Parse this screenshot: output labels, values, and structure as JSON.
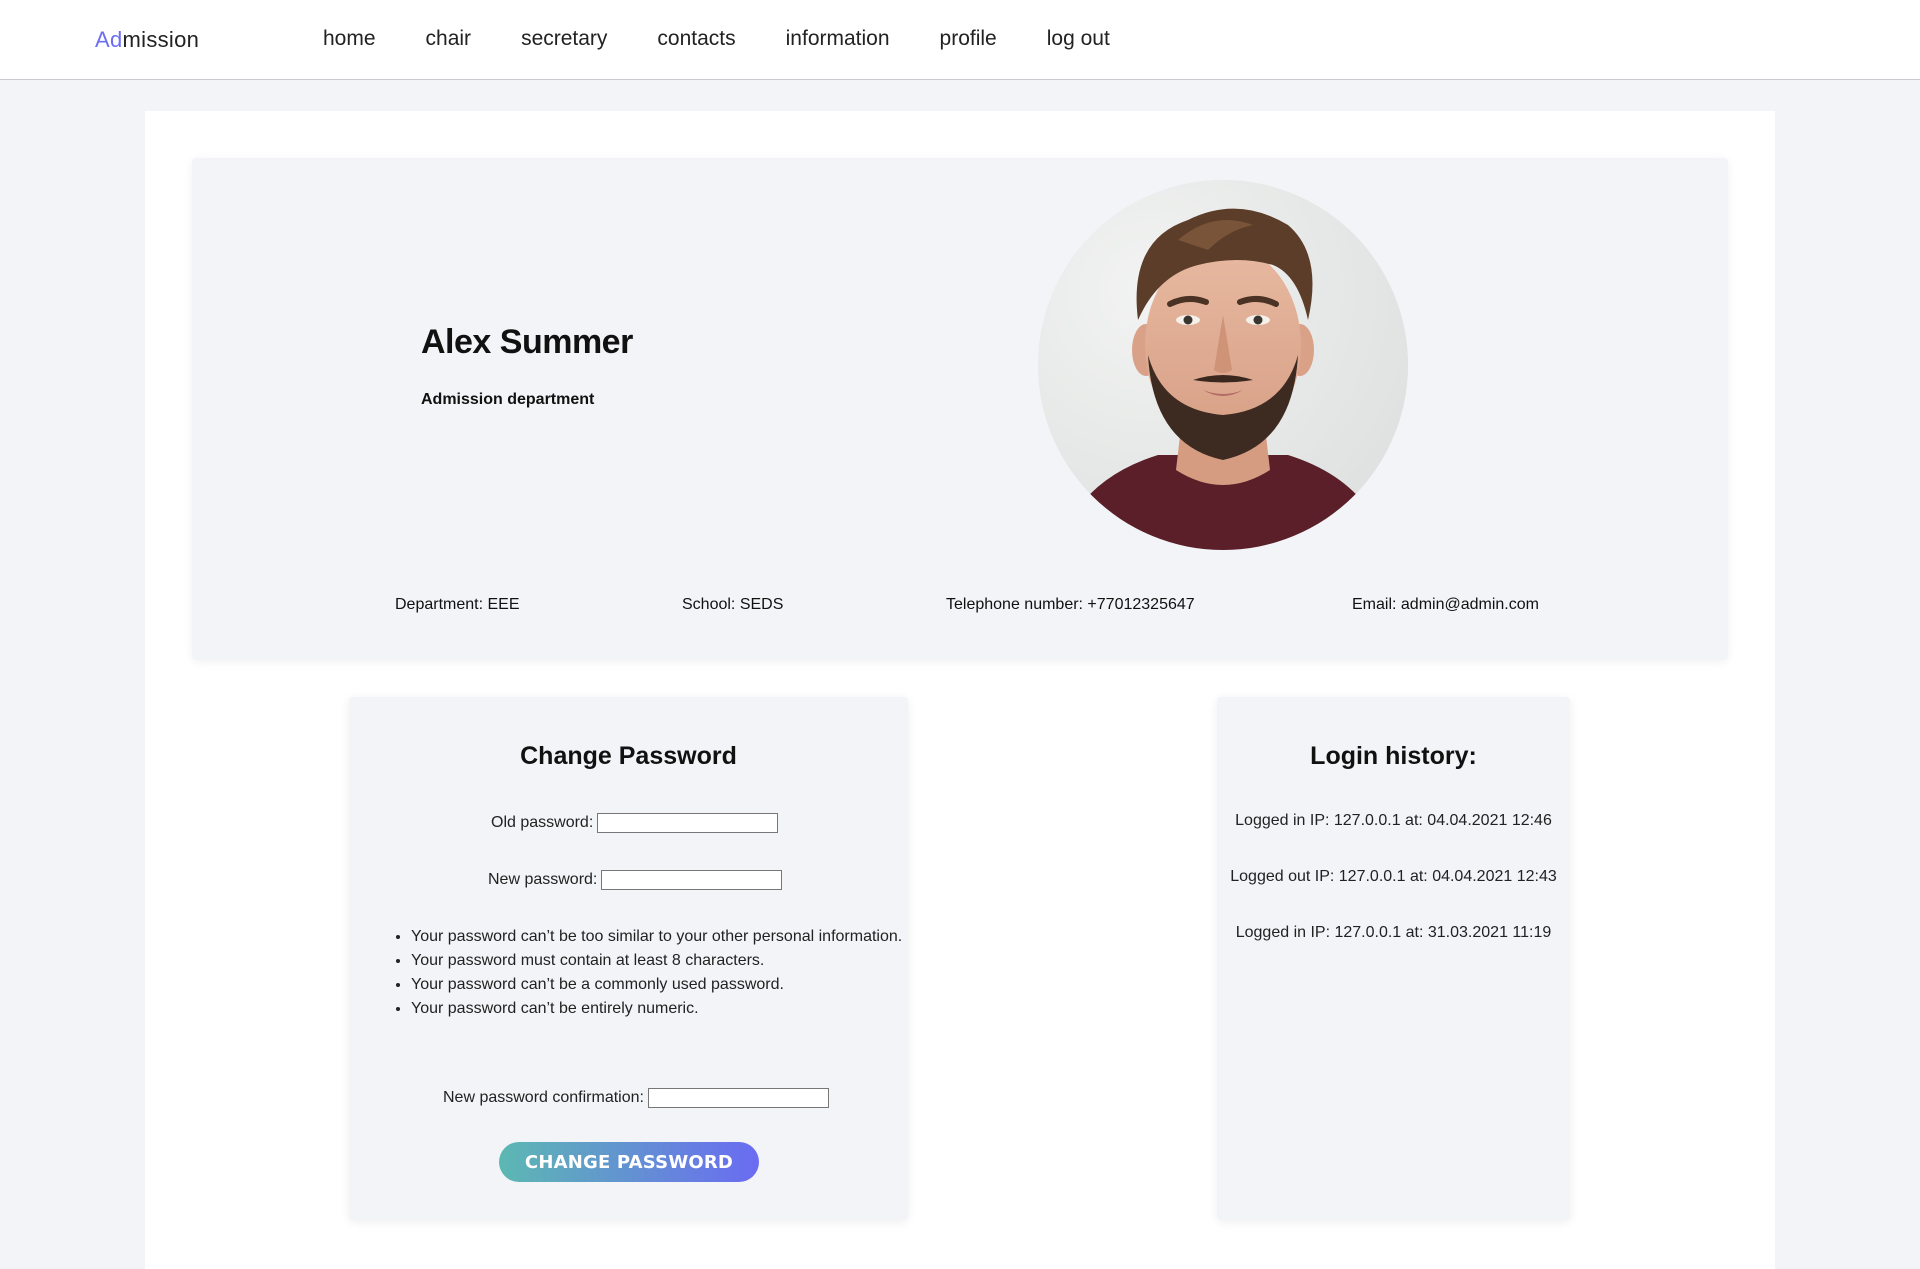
{
  "nav": {
    "brand_accent": "Ad",
    "brand_rest": "mission",
    "links": [
      "home",
      "chair",
      "secretary",
      "contacts",
      "information",
      "profile",
      "log out"
    ]
  },
  "profile": {
    "name": "Alex Summer",
    "department_title": "Admission department",
    "department": "Department: EEE",
    "school": "School: SEDS",
    "telephone": "Telephone number: +77012325647",
    "email": "Email: admin@admin.com"
  },
  "change_password": {
    "title": "Change Password",
    "old_label": "Old password:",
    "new_label": "New password:",
    "confirm_label": "New password confirmation:",
    "old_value": "",
    "new_value": "",
    "confirm_value": "",
    "rules": [
      "Your password can’t be too similar to your other personal information.",
      "Your password must contain at least 8 characters.",
      "Your password can’t be a commonly used password.",
      "Your password can’t be entirely numeric."
    ],
    "button_label": "CHANGE PASSWORD"
  },
  "login_history": {
    "title": "Login history:",
    "entries": [
      "Logged in IP: 127.0.0.1 at: 04.04.2021 12:46",
      "Logged out IP: 127.0.0.1 at: 04.04.2021 12:43",
      "Logged in IP: 127.0.0.1 at: 31.03.2021 11:19"
    ]
  },
  "colors": {
    "accent": "#6b6ef0",
    "button_gradient_start": "#5cb8b2",
    "button_gradient_end": "#6a6bf2",
    "page_bg": "#f3f4f7"
  }
}
